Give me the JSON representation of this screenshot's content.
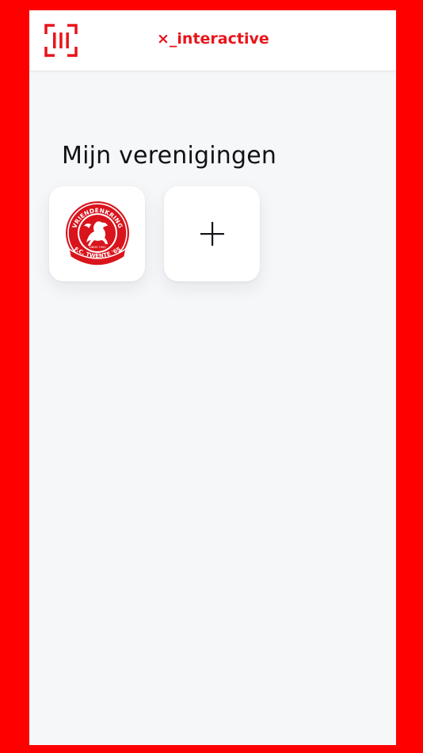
{
  "header": {
    "brand_x": "×",
    "brand_underscore": "_",
    "brand_word": "interactive",
    "scan_icon": "qr-scan-icon"
  },
  "main": {
    "title": "Mijn verenigingen",
    "clubs": [
      {
        "logo_icon": "fc-twente-vriendenkring-logo",
        "logo_text_top": "VRIENDENKRING",
        "logo_text_bottom": "F.C. TWENTE '65",
        "logo_text_small": "SINDS 1965"
      }
    ],
    "add_icon": "plus-icon"
  },
  "colors": {
    "frame": "#FF0000",
    "accent": "#E8141B",
    "background": "#F6F7F9",
    "card": "#FFFFFF",
    "text": "#111216"
  }
}
